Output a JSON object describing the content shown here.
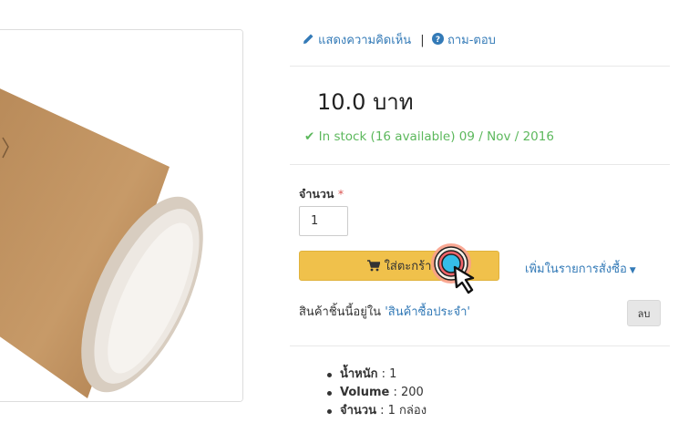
{
  "top_links": {
    "review": "แสดงความคิดเห็น",
    "separator": "|",
    "qa": "ถาม-ตอบ"
  },
  "price": "10.0 บาท",
  "stock": "In stock (16 available) 09 / Nov / 2016",
  "quantity": {
    "label": "จำนวน",
    "required_mark": "*",
    "value": "1"
  },
  "cart_button": {
    "label": "ใส่ตะกร้า"
  },
  "wishlist": {
    "label": "เพิ่มในรายการสั่งซื้อ"
  },
  "note": {
    "prefix": "สินค้าชิ้นนี้อยู่ใน",
    "link": "'สินค้าซื้อประจำ'"
  },
  "delete_button": {
    "label": "ลบ"
  },
  "specs": [
    {
      "key": "น้ำหนัก",
      "value": " : 1"
    },
    {
      "key": "Volume",
      "value": " : 200"
    },
    {
      "key": "จำนวน",
      "value": " : 1 กล่อง"
    }
  ],
  "colors": {
    "link": "#337ab7",
    "stock": "#5cb85c",
    "cart_button": "#f0c14b",
    "required": "#d9534f"
  },
  "icons": {
    "review": "pencil-icon",
    "qa": "question-circle-icon",
    "stock": "check-icon",
    "cart": "shopping-cart-icon",
    "wishlist": "caret-down-icon",
    "pointer": "hand-pointer-icon"
  }
}
